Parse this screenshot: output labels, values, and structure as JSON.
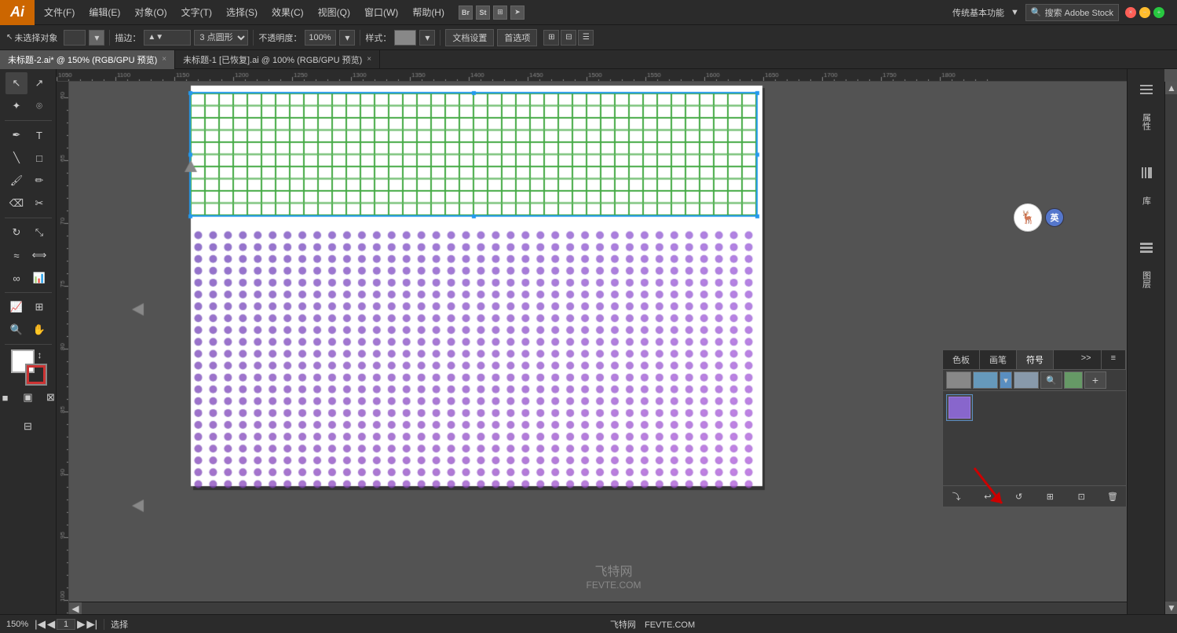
{
  "app": {
    "name": "Ai",
    "logo_color": "#CC6600"
  },
  "menu": {
    "items": [
      "文件(F)",
      "编辑(E)",
      "对象(O)",
      "文字(T)",
      "选择(S)",
      "效果(C)",
      "视图(Q)",
      "窗口(W)",
      "帮助(H)"
    ],
    "right_label": "传统基本功能",
    "search_placeholder": "搜索 Adobe Stock"
  },
  "toolbar": {
    "selection_label": "未选择对象",
    "stroke_label": "描边：",
    "dot_size": "3 点圆形",
    "opacity_label": "不透明度：",
    "opacity_value": "100%",
    "style_label": "样式：",
    "doc_setup_label": "文档设置",
    "preferences_label": "首选项"
  },
  "tabs": [
    {
      "label": "未标题-2.ai* @ 150% (RGB/GPU 预览)",
      "active": true
    },
    {
      "label": "未标题-1 [已恢复].ai @ 100% (RGB/GPU 预览)",
      "active": false
    }
  ],
  "panels": {
    "properties_label": "属性",
    "library_label": "库",
    "layers_label": "图层"
  },
  "symbol_panel": {
    "tabs": [
      "色板",
      "画笔",
      "符号"
    ],
    "active_tab": "符号",
    "options_label": ">>",
    "menu_label": "≡"
  },
  "status_bar": {
    "zoom": "150%",
    "page": "1",
    "selection_label": "选择",
    "watermark_line1": "飞特网",
    "watermark_line2": "FEVTE.COM"
  },
  "canvas": {
    "rect_fill": "#ffffff",
    "rect_stroke": "#44aa44",
    "rect_border": "#3399ff",
    "dot_color_purple": "#8866cc",
    "dot_color_blue": "#6677dd"
  }
}
